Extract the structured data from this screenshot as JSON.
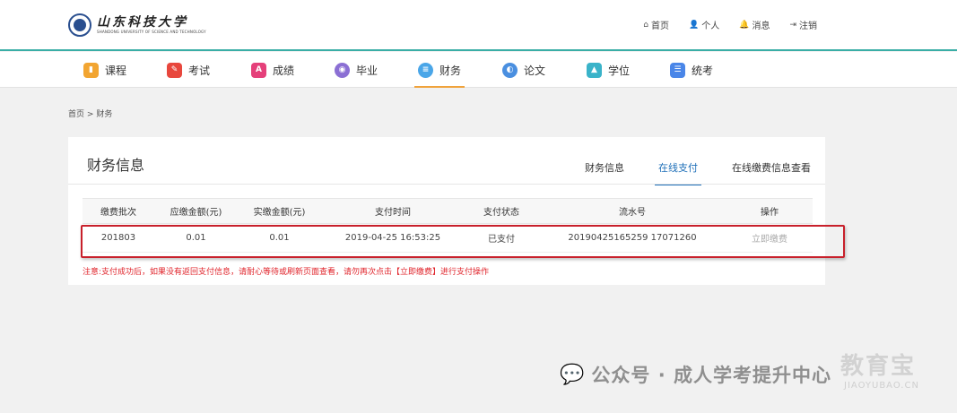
{
  "logo": {
    "name_cn": "山东科技大学",
    "name_en": "SHANDONG UNIVERSITY OF SCIENCE AND TECHNOLOGY"
  },
  "topnav": [
    {
      "label": "首页",
      "icon": "home-icon",
      "glyph": "⌂"
    },
    {
      "label": "个人",
      "icon": "user-icon",
      "glyph": "👤"
    },
    {
      "label": "消息",
      "icon": "bell-icon",
      "glyph": "🔔"
    },
    {
      "label": "注销",
      "icon": "logout-icon",
      "glyph": "⇥"
    }
  ],
  "modules": [
    {
      "label": "课程",
      "icon": "course-icon",
      "color": "#f2a531"
    },
    {
      "label": "考试",
      "icon": "exam-icon",
      "color": "#e8473d"
    },
    {
      "label": "成绩",
      "icon": "score-icon",
      "color": "#e5407a"
    },
    {
      "label": "毕业",
      "icon": "graduation-icon",
      "color": "#8b6fd4"
    },
    {
      "label": "财务",
      "icon": "finance-icon",
      "color": "#4aa6e8",
      "active": true
    },
    {
      "label": "论文",
      "icon": "paper-icon",
      "color": "#4a8fe0"
    },
    {
      "label": "学位",
      "icon": "degree-cap-icon",
      "color": "#3ab3c9"
    },
    {
      "label": "统考",
      "icon": "unified-exam-icon",
      "color": "#4a86e8"
    }
  ],
  "breadcrumb": {
    "home": "首页",
    "separator": ">",
    "current": "财务"
  },
  "panel": {
    "title": "财务信息",
    "tabs": [
      {
        "label": "财务信息",
        "active": false
      },
      {
        "label": "在线支付",
        "active": true
      },
      {
        "label": "在线缴费信息查看",
        "active": false
      }
    ]
  },
  "table": {
    "headers": [
      "缴费批次",
      "应缴金额(元)",
      "实缴金额(元)",
      "支付时间",
      "支付状态",
      "流水号",
      "操作"
    ],
    "rows": [
      [
        "201803",
        "0.01",
        "0.01",
        "2019-04-25 16:53:25",
        "已支付",
        "20190425165259 17071260",
        "立即缴费"
      ]
    ]
  },
  "notice": "注意:支付成功后，如果没有返回支付信息，请耐心等待或刷新页面查看，请勿再次点击【立即缴费】进行支付操作",
  "watermark": {
    "text": "公众号 · 成人学考提升中心",
    "brand": "教育宝",
    "brand_domain": "JIAOYUBAO.CN"
  },
  "colors": {
    "accent_teal": "#3aaea6",
    "active_tab": "#1e6fb8",
    "active_module": "#f0a33c",
    "notice_red": "#e0242b",
    "highlight_box": "#c8202b"
  }
}
